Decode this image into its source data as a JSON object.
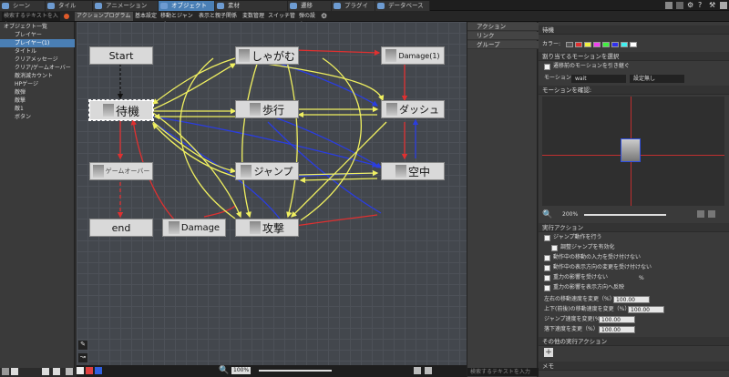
{
  "tabs": [
    "シーン",
    "タイル",
    "アニメーション",
    "オブジェクト",
    "素材",
    "遷移",
    "プラグイン",
    "データベース"
  ],
  "subtabs": [
    "検索するテキストを入力",
    "アクションプログラム",
    "基本設定",
    "移動とジャンプ",
    "表示と親子関係",
    "変数管理",
    "スイッチ管理",
    "弾の設定"
  ],
  "tree": [
    "オブジェクト一覧",
    "プレイヤー",
    "プレイヤー(1)",
    "タイトル",
    "クリアメッセージ",
    "クリア/ゲームオーバー",
    "敵消滅カウント",
    "HPゲージ",
    "敵弾",
    "敵撃",
    "敵1",
    "ボタン"
  ],
  "nodes": {
    "start": "Start",
    "taiki": "待機",
    "shagamu": "しゃがむ",
    "damage1": "Damage(1)",
    "hokou": "歩行",
    "dash": "ダッシュ",
    "gameover": "ゲームオーバー",
    "jump": "ジャンプ",
    "kuchu": "空中",
    "end": "end",
    "damage": "Damage",
    "kogeki": "攻撃"
  },
  "zoom_canvas": "100%",
  "zoom_preview": "200%",
  "link_panel": {
    "items": [
      "アクション",
      "リンク",
      "グループ"
    ],
    "search_placeholder": "検索するテキストを入力"
  },
  "right": {
    "title": "待機",
    "color_label": "カラー:",
    "colors": [
      "#555555",
      "#e03030",
      "#f0f040",
      "#f040f0",
      "#40f040",
      "#3030f0",
      "#40f0f0",
      "#ffffff"
    ],
    "section_motion": "割り当てるモーションを選択",
    "cb_inherit": "遷移前のモーションを引き継ぐ",
    "motion_label": "モーション:",
    "motion_value": "wait",
    "motion_setting": "設定無し",
    "preview_label": "モーションを確認:",
    "section_exec": "実行アクション",
    "cb_jump": "ジャンプ動作を行う",
    "cb_jumpsub": "調整ジャンプを有効化",
    "cb_move": "動作中の移動の入力を受け付けない",
    "cb_dir": "動作中の表示方向の変更を受け付けない",
    "cb_gravity": "重力の影響を受けない",
    "cb_gravity_pct": "%",
    "cb_gravity2": "重力の影響を表示方向へ反映",
    "f1_label": "左右の移動速度を変更（%）",
    "f1_val": "100.00",
    "f2_label": "上下(前後)の移動速度を変更（%）",
    "f2_val": "100.00",
    "f3_label": "ジャンプ速度を変更(%)",
    "f3_val": "100.00",
    "f4_label": "落下速度を変更（%）",
    "f4_val": "100.00",
    "section_other": "その他の実行アクション",
    "section_memo": "メモ"
  }
}
